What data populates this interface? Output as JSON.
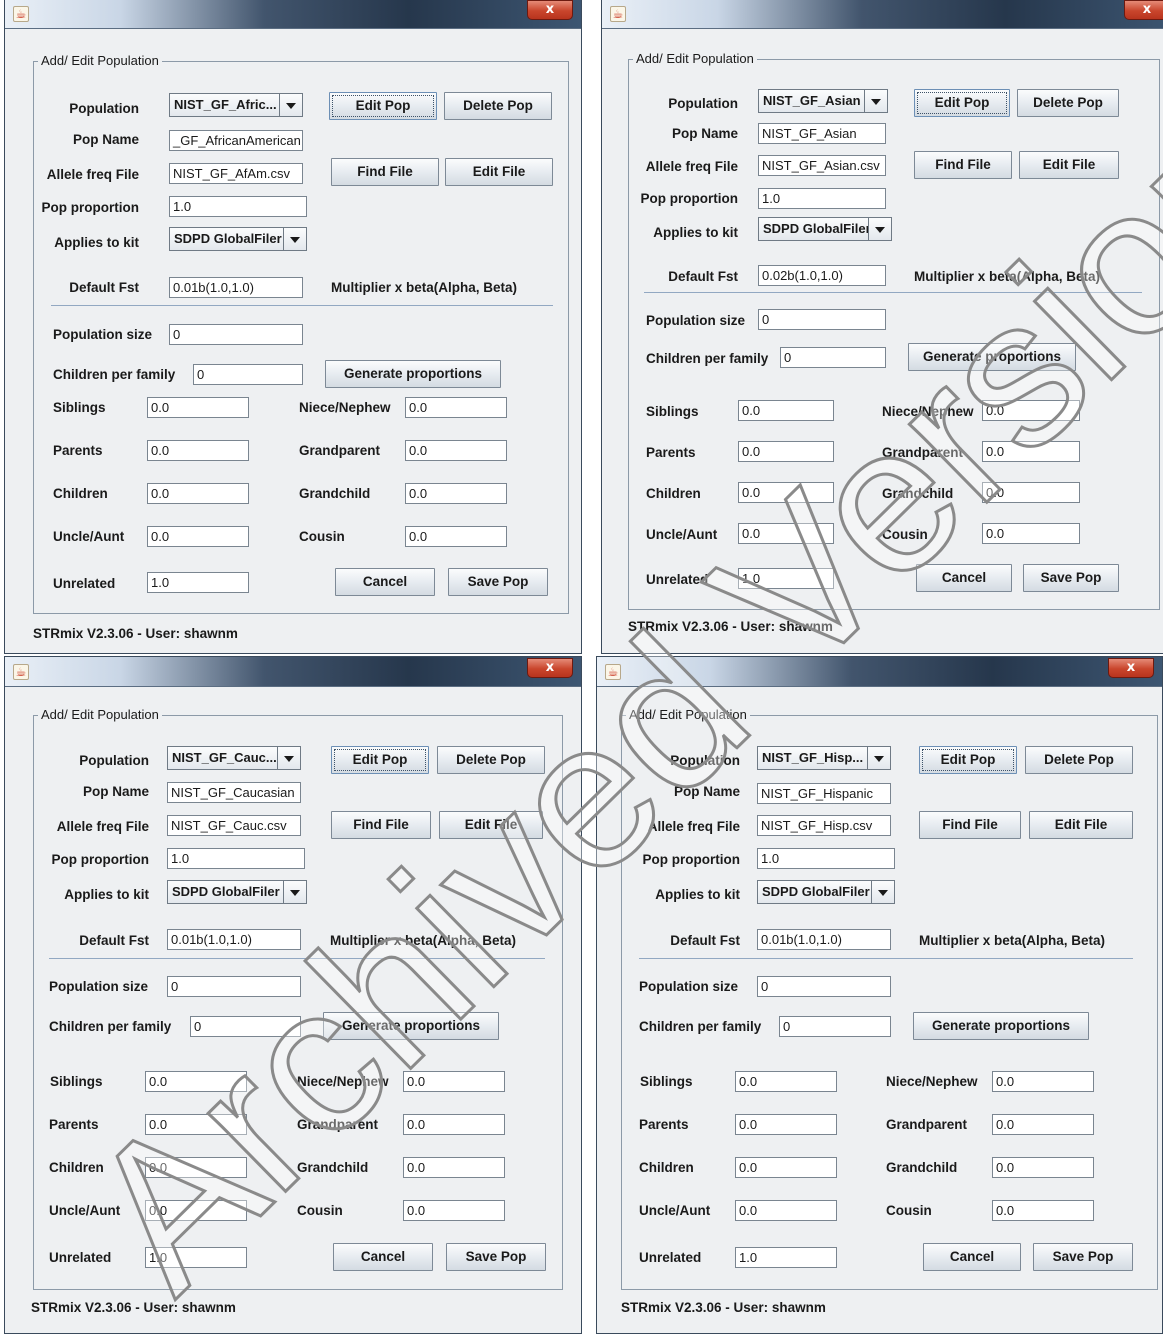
{
  "windows": [
    {
      "group_title": "Add/ Edit Population",
      "population": "NIST_GF_Afric...",
      "pop_name": "_GF_AfricanAmerican",
      "allele_file": "NIST_GF_AfAm.csv",
      "pop_proportion": "1.0",
      "applies_kit": "SDPD GlobalFiler",
      "default_fst": "0.01b(1.0,1.0)",
      "population_size": "0",
      "children_per_family": "0",
      "siblings": "0.0",
      "niece_nephew": "0.0",
      "parents": "0.0",
      "grandparent": "0.0",
      "children": "0.0",
      "grandchild": "0.0",
      "uncle_aunt": "0.0",
      "cousin": "0.0",
      "unrelated": "1.0",
      "status": "STRmix V2.3.06 - User: shawnm"
    },
    {
      "group_title": "Add/ Edit Population",
      "population": "NIST_GF_Asian",
      "pop_name": "NIST_GF_Asian",
      "allele_file": "NIST_GF_Asian.csv",
      "pop_proportion": "1.0",
      "applies_kit": "SDPD GlobalFiler",
      "default_fst": "0.02b(1.0,1.0)",
      "population_size": "0",
      "children_per_family": "0",
      "siblings": "0.0",
      "niece_nephew": "0.0",
      "parents": "0.0",
      "grandparent": "0.0",
      "children": "0.0",
      "grandchild": "0.0",
      "uncle_aunt": "0.0",
      "cousin": "0.0",
      "unrelated": "1.0",
      "status": "STRmix V2.3.06 - User: shawnm"
    },
    {
      "group_title": "Add/ Edit Population",
      "population": "NIST_GF_Cauc...",
      "pop_name": "NIST_GF_Caucasian",
      "allele_file": "NIST_GF_Cauc.csv",
      "pop_proportion": "1.0",
      "applies_kit": "SDPD GlobalFiler",
      "default_fst": "0.01b(1.0,1.0)",
      "population_size": "0",
      "children_per_family": "0",
      "siblings": "0.0",
      "niece_nephew": "0.0",
      "parents": "0.0",
      "grandparent": "0.0",
      "children": "0.0",
      "grandchild": "0.0",
      "uncle_aunt": "0.0",
      "cousin": "0.0",
      "unrelated": "1.0",
      "status": "STRmix V2.3.06 - User: shawnm"
    },
    {
      "group_title": "Add/ Edit Population",
      "population": "NIST_GF_Hisp...",
      "pop_name": "NIST_GF_Hispanic",
      "allele_file": "NIST_GF_Hisp.csv",
      "pop_proportion": "1.0",
      "applies_kit": "SDPD GlobalFiler",
      "default_fst": "0.01b(1.0,1.0)",
      "population_size": "0",
      "children_per_family": "0",
      "siblings": "0.0",
      "niece_nephew": "0.0",
      "parents": "0.0",
      "grandparent": "0.0",
      "children": "0.0",
      "grandchild": "0.0",
      "uncle_aunt": "0.0",
      "cousin": "0.0",
      "unrelated": "1.0",
      "status": "STRmix V2.3.06 - User: shawnm"
    }
  ],
  "labels": {
    "close_glyph": "x",
    "java_glyph": "☕",
    "population": "Population",
    "pop_name": "Pop Name",
    "allele_file": "Allele freq  File",
    "pop_proportion": "Pop proportion",
    "applies_kit": "Applies to kit",
    "default_fst": "Default Fst",
    "multiplier": "Multiplier x beta(Alpha, Beta)",
    "population_size": "Population size",
    "children_per_family": "Children per family",
    "siblings": "Siblings",
    "niece_nephew": "Niece/Nephew",
    "parents": "Parents",
    "grandparent": "Grandparent",
    "children": "Children",
    "grandchild": "Grandchild",
    "uncle_aunt": "Uncle/Aunt",
    "cousin": "Cousin",
    "unrelated": "Unrelated"
  },
  "buttons": {
    "edit_pop": "Edit Pop",
    "delete_pop": "Delete Pop",
    "find_file": "Find File",
    "edit_file": "Edit File",
    "generate_proportions": "Generate proportions",
    "cancel": "Cancel",
    "save_pop": "Save Pop"
  },
  "watermark": "Archived Version"
}
